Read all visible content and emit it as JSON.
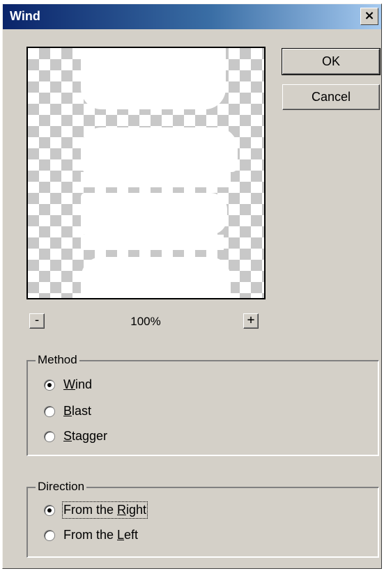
{
  "window": {
    "title": "Wind",
    "close_label": "×"
  },
  "buttons": {
    "ok_label": "OK",
    "cancel_label": "Cancel"
  },
  "zoom": {
    "minus_label": "-",
    "plus_label": "+",
    "level": "100%"
  },
  "method": {
    "legend": "Method",
    "selected": "Wind",
    "options": [
      {
        "label": "Wind",
        "mnemonic": "W",
        "rest": "ind",
        "checked": true
      },
      {
        "label": "Blast",
        "mnemonic": "B",
        "rest": "last",
        "checked": false
      },
      {
        "label": "Stagger",
        "mnemonic": "S",
        "rest": "tagger",
        "checked": false
      }
    ]
  },
  "direction": {
    "legend": "Direction",
    "selected": "From the Right",
    "options": [
      {
        "label": "From the Right",
        "prefix": "From the ",
        "mnemonic": "R",
        "rest": "ight",
        "checked": true
      },
      {
        "label": "From the Left",
        "prefix": "From the ",
        "mnemonic": "L",
        "rest": "eft",
        "checked": false
      }
    ]
  },
  "colors": {
    "dialog_bg": "#d4d0c8",
    "titlebar_start": "#0a246a",
    "titlebar_end": "#a6caf0",
    "checker": "#c8c8c8"
  }
}
